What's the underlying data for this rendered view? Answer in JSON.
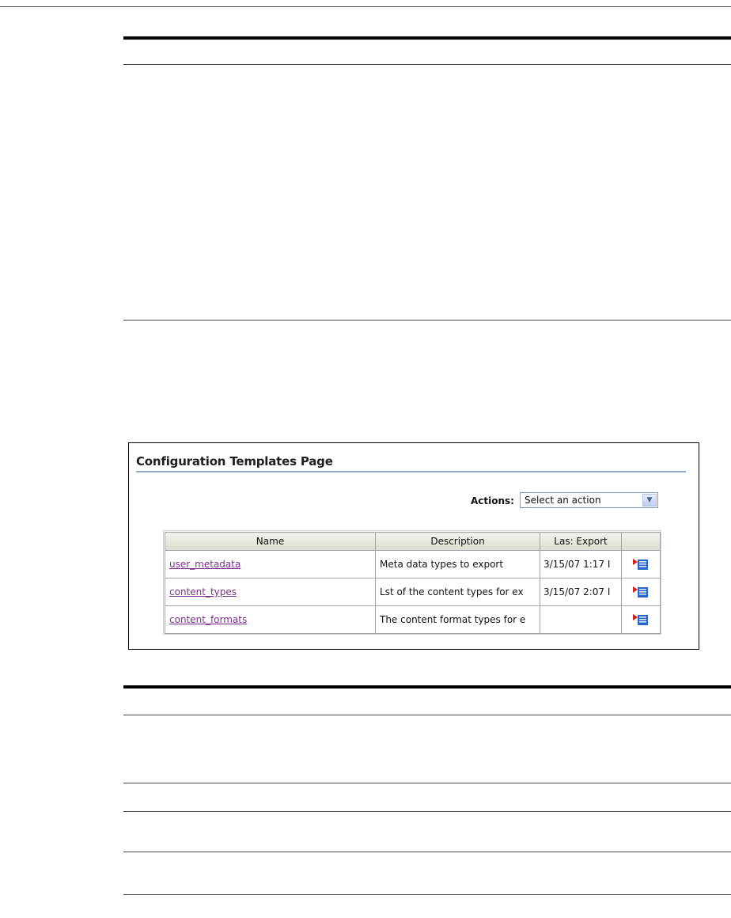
{
  "figure": {
    "title": "Configuration Templates Page",
    "actions_label": "Actions:",
    "actions_select_value": "Select an action",
    "table": {
      "columns": [
        "Name",
        "Description",
        "Las: Export",
        ""
      ],
      "rows": [
        {
          "name": "user_metadata",
          "description": "Meta data types to export",
          "last_export": "3/15/07 1:17 I"
        },
        {
          "name": "content_types",
          "description": "Lst of the content types for ex",
          "last_export": "3/15/07 2:07 I"
        },
        {
          "name": "content_formats",
          "description": "The content format types for e",
          "last_export": ""
        }
      ]
    }
  },
  "colors": {
    "link": "#7b2f8c",
    "title_underline": "#8fa8cc",
    "header_bg": "#dcdccf",
    "icon_blue": "#2a64c8",
    "icon_red": "#d0201c"
  }
}
